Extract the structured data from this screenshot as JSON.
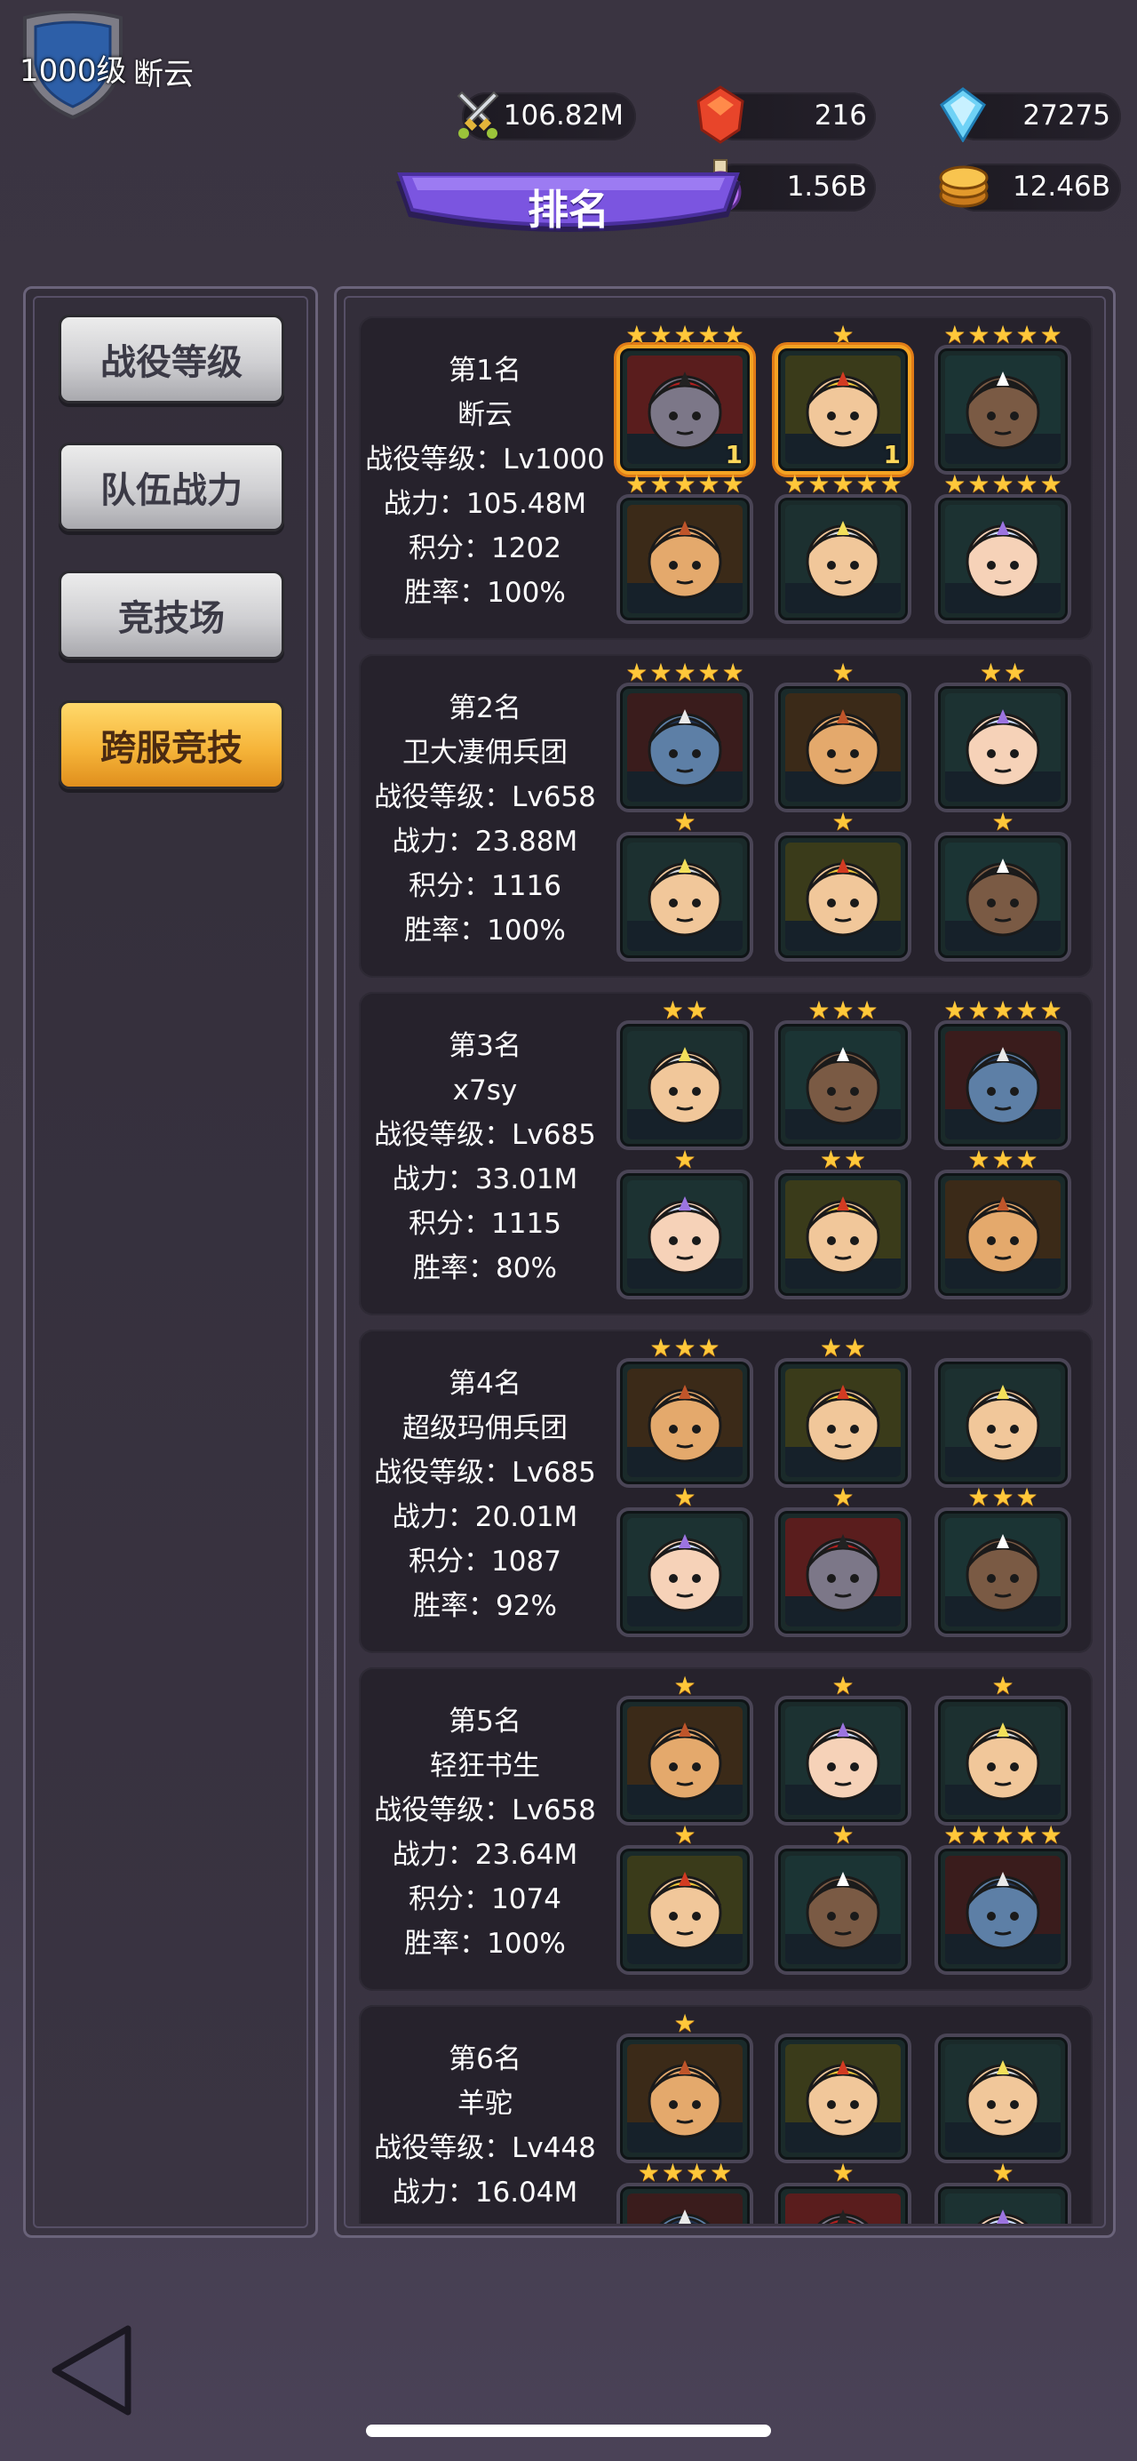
{
  "header": {
    "level": "1000级",
    "player_name": "断云",
    "title": "排名"
  },
  "resources": [
    {
      "name": "power",
      "icon": "crossed-swords-icon",
      "value": "106.82M"
    },
    {
      "name": "ruby",
      "icon": "red-gem-icon",
      "value": "216"
    },
    {
      "name": "diamond",
      "icon": "blue-diamond-icon",
      "value": "27275"
    },
    {
      "name": "potion",
      "icon": "purple-potion-icon",
      "value": "1.56B"
    },
    {
      "name": "gold",
      "icon": "gold-coin-icon",
      "value": "12.46B"
    }
  ],
  "tabs": [
    {
      "label": "战役等级",
      "active": false
    },
    {
      "label": "队伍战力",
      "active": false
    },
    {
      "label": "竞技场",
      "active": false
    },
    {
      "label": "跨服竞技",
      "active": true
    }
  ],
  "rankings": [
    {
      "rank": "第1名",
      "name": "断云",
      "campaign": "战役等级：Lv1000",
      "power": "战力：105.48M",
      "score": "积分：1202",
      "winrate": "胜率：100%",
      "heroes": [
        {
          "hero": "red-masked-ninja",
          "stars": 5,
          "badge": "1",
          "gold": true
        },
        {
          "hero": "golden-helm-warrior",
          "stars": 1,
          "badge": "1",
          "gold": true
        },
        {
          "hero": "pirate-skeleton",
          "stars": 5
        },
        {
          "hero": "bald-monk",
          "stars": 5
        },
        {
          "hero": "crystal-knight",
          "stars": 5
        },
        {
          "hero": "bunny-girl",
          "stars": 5
        }
      ]
    },
    {
      "rank": "第2名",
      "name": "卫大凄佣兵团",
      "campaign": "战役等级：Lv658",
      "power": "战力：23.88M",
      "score": "积分：1116",
      "winrate": "胜率：100%",
      "heroes": [
        {
          "hero": "horned-beast",
          "stars": 5
        },
        {
          "hero": "bald-monk",
          "stars": 1
        },
        {
          "hero": "bunny-girl",
          "stars": 2
        },
        {
          "hero": "crystal-knight",
          "stars": 1
        },
        {
          "hero": "golden-helm-warrior",
          "stars": 1
        },
        {
          "hero": "pirate-skeleton",
          "stars": 1
        }
      ]
    },
    {
      "rank": "第3名",
      "name": "x7sy",
      "campaign": "战役等级：Lv685",
      "power": "战力：33.01M",
      "score": "积分：1115",
      "winrate": "胜率：80%",
      "heroes": [
        {
          "hero": "crystal-knight",
          "stars": 2
        },
        {
          "hero": "pirate-skeleton",
          "stars": 3
        },
        {
          "hero": "horned-beast",
          "stars": 5
        },
        {
          "hero": "bunny-girl",
          "stars": 1
        },
        {
          "hero": "golden-helm-warrior",
          "stars": 2
        },
        {
          "hero": "bald-monk",
          "stars": 3
        }
      ]
    },
    {
      "rank": "第4名",
      "name": "超级玛佣兵团",
      "campaign": "战役等级：Lv685",
      "power": "战力：20.01M",
      "score": "积分：1087",
      "winrate": "胜率：92%",
      "heroes": [
        {
          "hero": "bald-monk",
          "stars": 3
        },
        {
          "hero": "golden-helm-warrior",
          "stars": 2
        },
        {
          "hero": "crystal-knight",
          "stars": 0
        },
        {
          "hero": "bunny-girl",
          "stars": 1
        },
        {
          "hero": "red-masked-ninja",
          "stars": 1
        },
        {
          "hero": "pirate-skeleton",
          "stars": 3
        }
      ]
    },
    {
      "rank": "第5名",
      "name": "轻狂书生",
      "campaign": "战役等级：Lv658",
      "power": "战力：23.64M",
      "score": "积分：1074",
      "winrate": "胜率：100%",
      "heroes": [
        {
          "hero": "bald-monk",
          "stars": 1
        },
        {
          "hero": "bunny-girl",
          "stars": 1
        },
        {
          "hero": "crystal-knight",
          "stars": 1
        },
        {
          "hero": "golden-helm-warrior",
          "stars": 1
        },
        {
          "hero": "pirate-skeleton",
          "stars": 1
        },
        {
          "hero": "horned-beast",
          "stars": 5
        }
      ]
    },
    {
      "rank": "第6名",
      "name": "羊驼",
      "campaign": "战役等级：Lv448",
      "power": "战力：16.04M",
      "score": "",
      "winrate": "",
      "heroes": [
        {
          "hero": "bald-monk",
          "stars": 1
        },
        {
          "hero": "golden-helm-warrior",
          "stars": 0
        },
        {
          "hero": "crystal-knight",
          "stars": 0
        },
        {
          "hero": "horned-beast",
          "stars": 4
        },
        {
          "hero": "red-masked-ninja",
          "stars": 1
        },
        {
          "hero": "bunny-girl",
          "stars": 1
        }
      ]
    }
  ],
  "colors": {
    "accent_gold": "#f6b53a",
    "banner_purple": "#7b55e0",
    "star": "#ffc83a"
  }
}
